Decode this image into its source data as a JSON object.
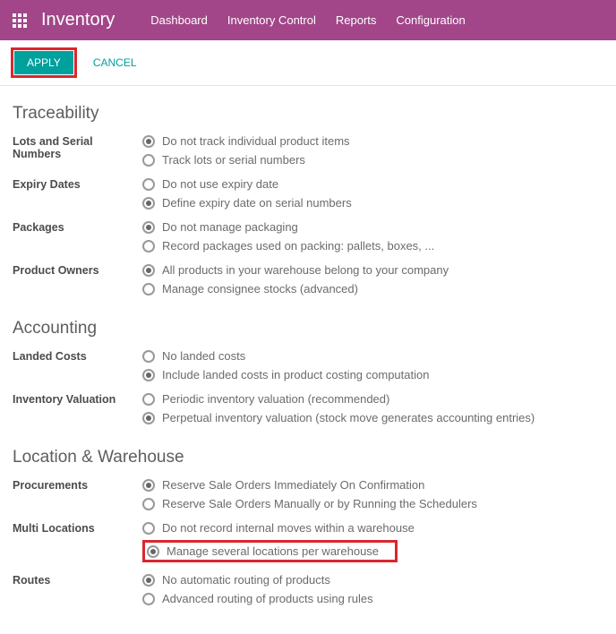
{
  "navbar": {
    "brand": "Inventory",
    "links": [
      "Dashboard",
      "Inventory Control",
      "Reports",
      "Configuration"
    ]
  },
  "actions": {
    "apply": "APPLY",
    "cancel": "CANCEL"
  },
  "sections": {
    "traceability": {
      "title": "Traceability",
      "lotsLabel": "Lots and Serial Numbers",
      "lots": [
        "Do not track individual product items",
        "Track lots or serial numbers"
      ],
      "expiryLabel": "Expiry Dates",
      "expiry": [
        "Do not use expiry date",
        "Define expiry date on serial numbers"
      ],
      "packagesLabel": "Packages",
      "packages": [
        "Do not manage packaging",
        "Record packages used on packing: pallets, boxes, ..."
      ],
      "ownersLabel": "Product Owners",
      "owners": [
        "All products in your warehouse belong to your company",
        "Manage consignee stocks (advanced)"
      ]
    },
    "accounting": {
      "title": "Accounting",
      "landedLabel": "Landed Costs",
      "landed": [
        "No landed costs",
        "Include landed costs in product costing computation"
      ],
      "valuationLabel": "Inventory Valuation",
      "valuation": [
        "Periodic inventory valuation (recommended)",
        "Perpetual inventory valuation (stock move generates accounting entries)"
      ]
    },
    "location": {
      "title": "Location & Warehouse",
      "procLabel": "Procurements",
      "proc": [
        "Reserve Sale Orders Immediately On Confirmation",
        "Reserve Sale Orders Manually or by Running the Schedulers"
      ],
      "multiLabel": "Multi Locations",
      "multi": [
        "Do not record internal moves within a warehouse",
        "Manage several locations per warehouse"
      ],
      "routesLabel": "Routes",
      "routes": [
        "No automatic routing of products",
        "Advanced routing of products using rules"
      ]
    }
  }
}
